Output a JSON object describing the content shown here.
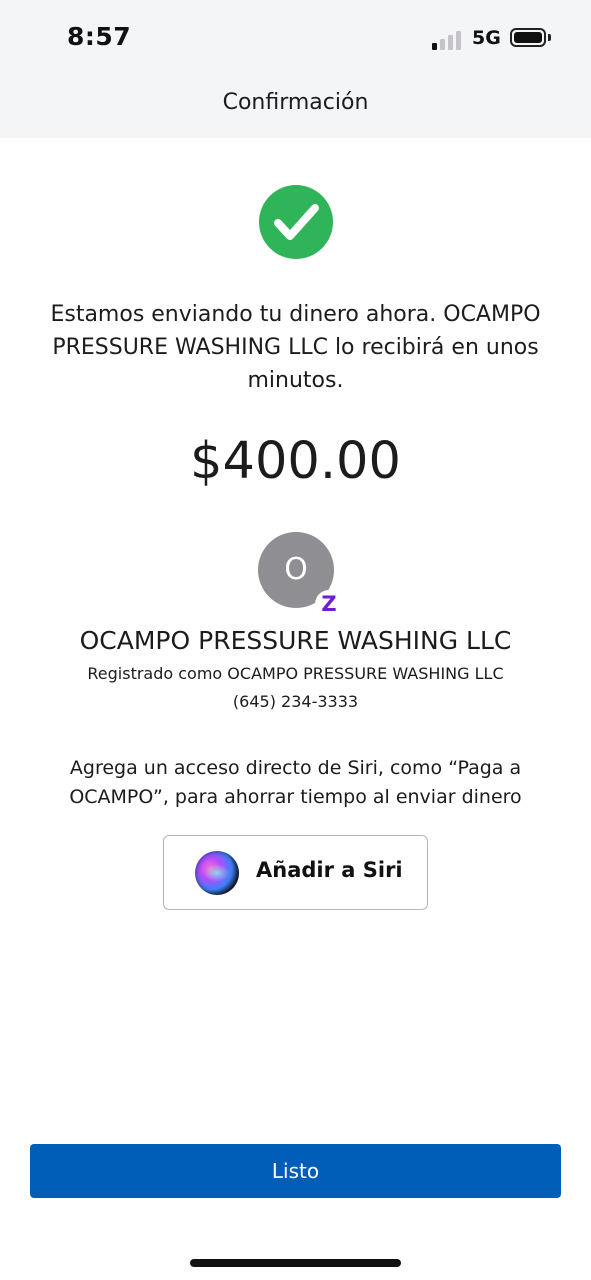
{
  "status_bar": {
    "time": "8:57",
    "network": "5G",
    "signal_bars_active": 1,
    "signal_bars_total": 4
  },
  "header": {
    "title": "Confirmación"
  },
  "confirmation": {
    "icon": "check-circle-icon",
    "icon_color": "#2fb45a",
    "message": "Estamos enviando tu dinero ahora. OCAMPO PRESSURE WASHING LLC lo recibirá en unos minutos.",
    "amount": "$400.00"
  },
  "recipient": {
    "avatar_initial": "O",
    "badge_icon": "zelle-icon",
    "badge_glyph": "Z",
    "badge_color": "#6d1ed4",
    "name": "OCAMPO PRESSURE WASHING LLC",
    "registered_as": "Registrado como OCAMPO PRESSURE WASHING LLC",
    "phone": "(645) 234-3333"
  },
  "siri": {
    "hint": "Agrega un acceso directo de Siri, como “Paga a OCAMPO”, para ahorrar tiempo al enviar dinero",
    "button_label": "Añadir a Siri",
    "icon": "siri-icon"
  },
  "footer": {
    "done_label": "Listo",
    "accent_color": "#005eb8"
  }
}
